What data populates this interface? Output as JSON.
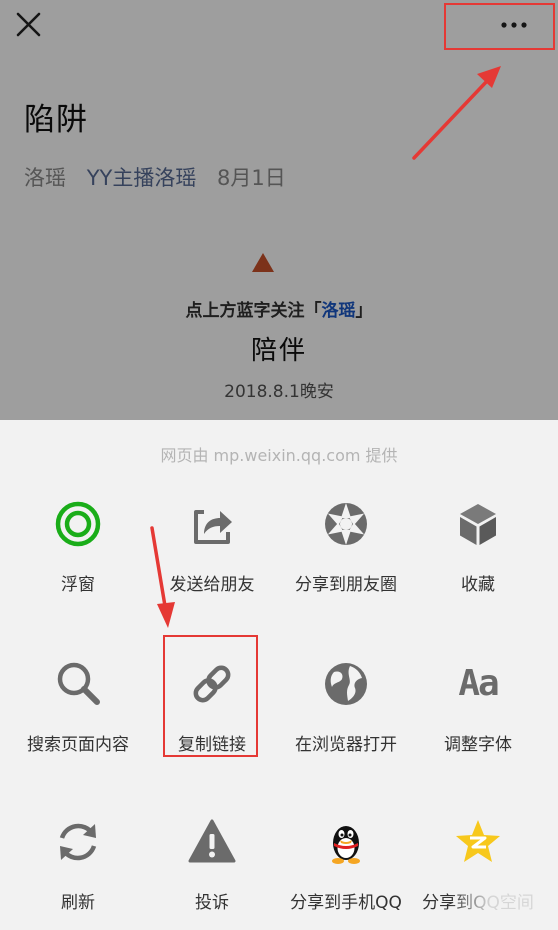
{
  "article": {
    "title": "陷阱",
    "author": "洛瑶",
    "account": "YY主播洛瑶",
    "date": "8月1日",
    "follow_prefix": "点上方蓝字关注「",
    "follow_name": "洛瑶",
    "follow_suffix": "」",
    "subtitle": "陪伴",
    "date_line": "2018.8.1晚安"
  },
  "sheet": {
    "provider": "网页由 mp.weixin.qq.com 提供",
    "items": [
      {
        "label": "浮窗",
        "icon": "floating-window-icon"
      },
      {
        "label": "发送给朋友",
        "icon": "send-to-friend-icon"
      },
      {
        "label": "分享到朋友圈",
        "icon": "moments-icon"
      },
      {
        "label": "收藏",
        "icon": "favorite-cube-icon"
      },
      {
        "label": "搜索页面内容",
        "icon": "search-icon"
      },
      {
        "label": "复制链接",
        "icon": "link-icon"
      },
      {
        "label": "在浏览器打开",
        "icon": "globe-icon"
      },
      {
        "label": "调整字体",
        "icon": "font-icon"
      },
      {
        "label": "刷新",
        "icon": "refresh-icon"
      },
      {
        "label": "投诉",
        "icon": "warning-icon"
      },
      {
        "label": "分享到手机QQ",
        "icon": "qq-icon"
      },
      {
        "label": "分享到QQ空间",
        "icon": "qzone-icon"
      }
    ]
  },
  "icons": {
    "font_glyph": "Aa"
  },
  "colors": {
    "accent_green": "#1aad19",
    "link_blue": "#576b95",
    "annotation_red": "#e53935",
    "icon_gray": "#6b6b6b"
  }
}
